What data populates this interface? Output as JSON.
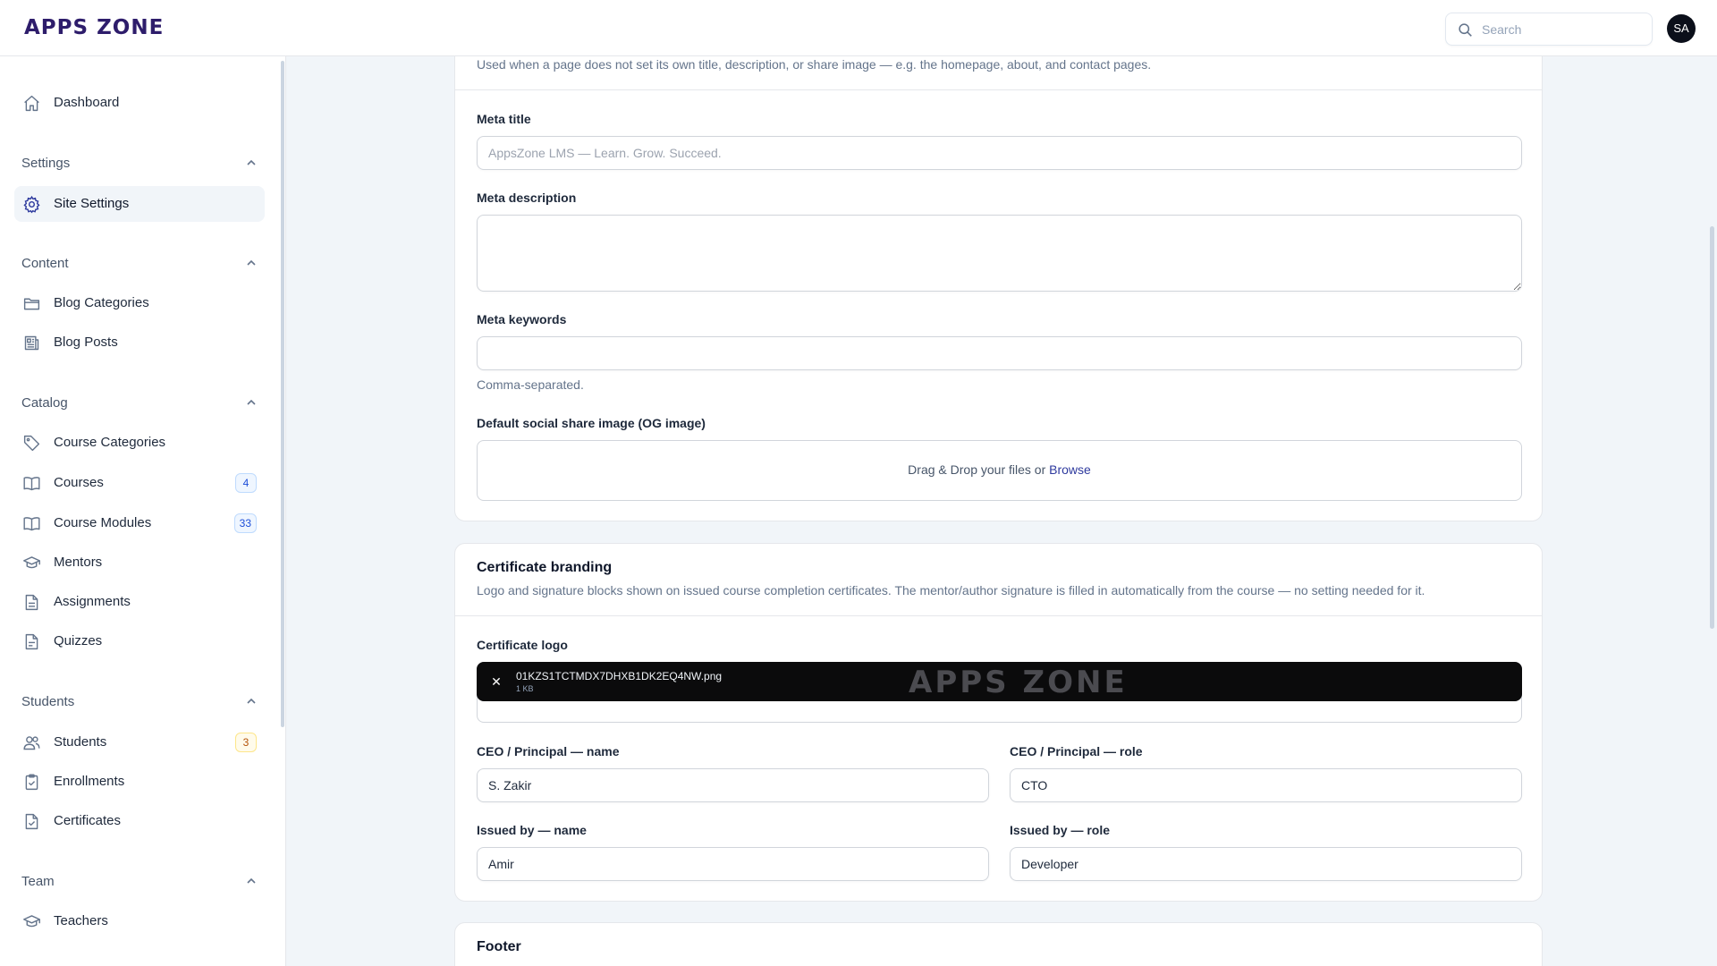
{
  "app": {
    "logo_text": "APPS ZONE"
  },
  "header": {
    "search_placeholder": "Search",
    "avatar_initials": "SA"
  },
  "sidebar": {
    "dashboard": "Dashboard",
    "groups": {
      "settings": "Settings",
      "content": "Content",
      "catalog": "Catalog",
      "students": "Students",
      "team": "Team"
    },
    "items": {
      "site_settings": "Site Settings",
      "blog_categories": "Blog Categories",
      "blog_posts": "Blog Posts",
      "course_categories": "Course Categories",
      "courses": "Courses",
      "courses_badge": "4",
      "course_modules": "Course Modules",
      "course_modules_badge": "33",
      "mentors": "Mentors",
      "assignments": "Assignments",
      "quizzes": "Quizzes",
      "students": "Students",
      "students_badge": "3",
      "enrollments": "Enrollments",
      "certificates": "Certificates",
      "teachers": "Teachers"
    }
  },
  "seo_section": {
    "description": "Used when a page does not set its own title, description, or share image — e.g. the homepage, about, and contact pages.",
    "meta_title_label": "Meta title",
    "meta_title_placeholder": "AppsZone LMS — Learn. Grow. Succeed.",
    "meta_description_label": "Meta description",
    "meta_keywords_label": "Meta keywords",
    "meta_keywords_help": "Comma-separated.",
    "og_image_label": "Default social share image (OG image)",
    "dropzone_text": "Drag & Drop your files or",
    "dropzone_browse": "Browse"
  },
  "certificate_section": {
    "title": "Certificate branding",
    "description": "Logo and signature blocks shown on issued course completion certificates. The mentor/author signature is filled in automatically from the course — no setting needed for it.",
    "logo_label": "Certificate logo",
    "logo_file_name": "01KZS1TCTMDX7DHXB1DK2EQ4NW.png",
    "logo_file_size": "1 KB",
    "logo_preview_text": "APPS ZONE",
    "ceo_name_label": "CEO / Principal — name",
    "ceo_name_value": "S. Zakir",
    "ceo_role_label": "CEO / Principal — role",
    "ceo_role_value": "CTO",
    "issued_name_label": "Issued by — name",
    "issued_name_value": "Amir",
    "issued_role_label": "Issued by — role",
    "issued_role_value": "Developer"
  },
  "footer_section": {
    "title": "Footer"
  }
}
